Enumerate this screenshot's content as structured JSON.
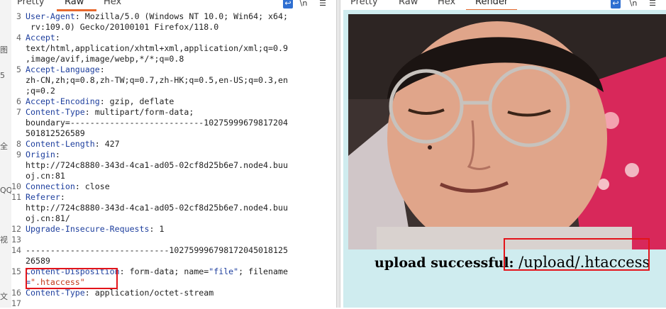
{
  "left_strip": {
    "chars": [
      "图",
      "5",
      "全",
      "QQ",
      "视",
      "文"
    ]
  },
  "request": {
    "tabs": [
      "Pretty",
      "Raw",
      "Hex"
    ],
    "active_tab": "Raw",
    "toolbar_icons": [
      "wrap-icon",
      "newline-icon",
      "menu-icon"
    ],
    "lines": [
      {
        "n": "3",
        "segs": [
          {
            "t": "User-Agent",
            "c": "hk"
          },
          {
            "t": ": Mozilla/5.0 (Windows NT 10.0; Win64; x64;"
          }
        ]
      },
      {
        "n": "",
        "segs": [
          {
            "t": " rv:109.0) Gecko/20100101 Firefox/118.0"
          }
        ]
      },
      {
        "n": "4",
        "segs": [
          {
            "t": "Accept",
            "c": "hk"
          },
          {
            "t": ":"
          }
        ]
      },
      {
        "n": "",
        "segs": [
          {
            "t": "text/html,application/xhtml+xml,application/xml;q=0.9"
          }
        ]
      },
      {
        "n": "",
        "segs": [
          {
            "t": ",image/avif,image/webp,*/*;q=0.8"
          }
        ]
      },
      {
        "n": "5",
        "segs": [
          {
            "t": "Accept-Language",
            "c": "hk"
          },
          {
            "t": ":"
          }
        ]
      },
      {
        "n": "",
        "segs": [
          {
            "t": "zh-CN,zh;q=0.8,zh-TW;q=0.7,zh-HK;q=0.5,en-US;q=0.3,en"
          }
        ]
      },
      {
        "n": "",
        "segs": [
          {
            "t": ";q=0.2"
          }
        ]
      },
      {
        "n": "6",
        "segs": [
          {
            "t": "Accept-Encoding",
            "c": "hk"
          },
          {
            "t": ": gzip, deflate"
          }
        ]
      },
      {
        "n": "7",
        "segs": [
          {
            "t": "Content-Type",
            "c": "hk"
          },
          {
            "t": ": multipart/form-data;"
          }
        ]
      },
      {
        "n": "",
        "segs": [
          {
            "t": "boundary=---------------------------10275999679817204"
          }
        ]
      },
      {
        "n": "",
        "segs": [
          {
            "t": "501812526589"
          }
        ]
      },
      {
        "n": "8",
        "segs": [
          {
            "t": "Content-Length",
            "c": "hk"
          },
          {
            "t": ": 427"
          }
        ]
      },
      {
        "n": "9",
        "segs": [
          {
            "t": "Origin",
            "c": "hk"
          },
          {
            "t": ":"
          }
        ]
      },
      {
        "n": "",
        "segs": [
          {
            "t": "http://724c8880-343d-4ca1-ad05-02cf8d25b6e7.node4.buu"
          }
        ]
      },
      {
        "n": "",
        "segs": [
          {
            "t": "oj.cn:81"
          }
        ]
      },
      {
        "n": "10",
        "segs": [
          {
            "t": "Connection",
            "c": "hk"
          },
          {
            "t": ": close"
          }
        ]
      },
      {
        "n": "11",
        "segs": [
          {
            "t": "Referer",
            "c": "hk"
          },
          {
            "t": ":"
          }
        ]
      },
      {
        "n": "",
        "segs": [
          {
            "t": "http://724c8880-343d-4ca1-ad05-02cf8d25b6e7.node4.buu"
          }
        ]
      },
      {
        "n": "",
        "segs": [
          {
            "t": "oj.cn:81/"
          }
        ]
      },
      {
        "n": "12",
        "segs": [
          {
            "t": "Upgrade-Insecure-Requests",
            "c": "hk"
          },
          {
            "t": ": 1"
          }
        ]
      },
      {
        "n": "13",
        "segs": [
          {
            "t": ""
          }
        ]
      },
      {
        "n": "14",
        "segs": [
          {
            "t": "-----------------------------102759996798172045018125"
          }
        ]
      },
      {
        "n": "",
        "segs": [
          {
            "t": "26589"
          }
        ]
      },
      {
        "n": "15",
        "segs": [
          {
            "t": "Content-Disposition",
            "c": "hk"
          },
          {
            "t": ": form-data; name="
          },
          {
            "t": "\"file\"",
            "c": "str"
          },
          {
            "t": "; filename"
          }
        ]
      },
      {
        "n": "",
        "segs": [
          {
            "t": "=",
            "c": "str"
          },
          {
            "t": "\".htaccess\"",
            "c": "hl"
          }
        ]
      },
      {
        "n": "16",
        "segs": [
          {
            "t": "Content-Type",
            "c": "hk"
          },
          {
            "t": ": application/octet-stream"
          }
        ]
      },
      {
        "n": "17",
        "segs": [
          {
            "t": ""
          }
        ]
      }
    ]
  },
  "response": {
    "tabs": [
      "Pretty",
      "Raw",
      "Hex",
      "Render"
    ],
    "active_tab": "Render",
    "toolbar_icons": [
      "wrap-icon",
      "newline-icon",
      "menu-icon"
    ],
    "upload_label": "upload successful: ",
    "upload_path": "/upload/.htaccess"
  },
  "colors": {
    "accent": "#e8692e",
    "highlight_box": "#e3141a",
    "render_bg": "#cfecef",
    "header_key": "#1e3f9e"
  }
}
